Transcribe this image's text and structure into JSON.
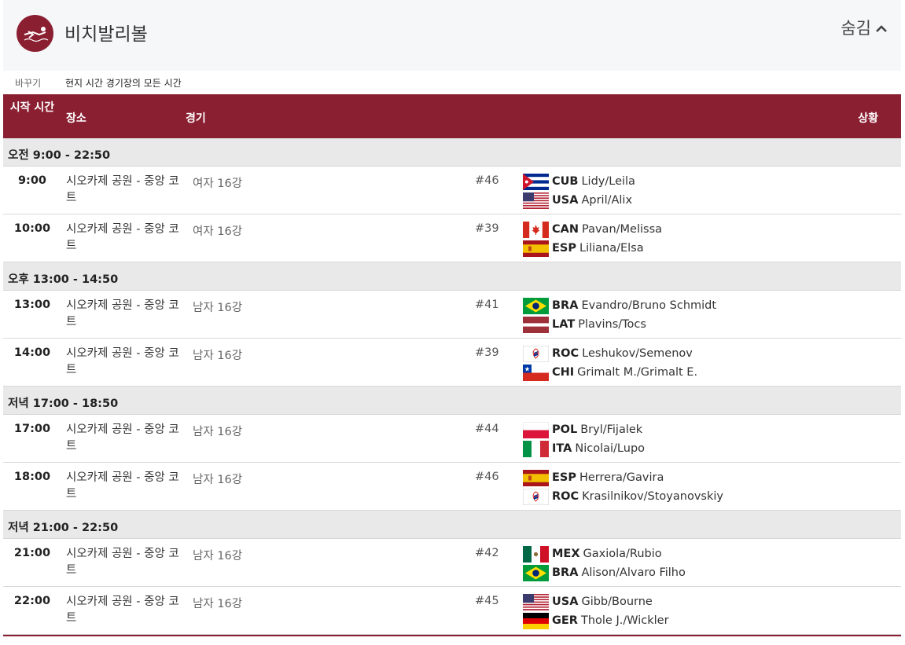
{
  "header": {
    "sport_name": "비치발리볼",
    "hide_label": "숨김"
  },
  "timezone": {
    "change_label": "바꾸기",
    "current_label": "현지 시간 경기장의 모든 시간"
  },
  "columns": {
    "time": "시작 시간",
    "venue": "장소",
    "event": "경기",
    "status": "상황"
  },
  "colors": {
    "brand": "#8b1f32",
    "header_bg": "#f6f7f9",
    "session_bg": "#e9e9e9"
  },
  "sessions": [
    {
      "label": "오전  9:00 - 22:50",
      "matches": [
        {
          "time": "9:00",
          "venue": "시오카제 공원 - 중앙 코트",
          "event": "여자 16강",
          "num": "#46",
          "teams": [
            {
              "flag": "CUB",
              "code": "CUB",
              "players": "Lidy/Leila"
            },
            {
              "flag": "USA",
              "code": "USA",
              "players": "April/Alix"
            }
          ]
        },
        {
          "time": "10:00",
          "venue": "시오카제 공원 - 중앙 코트",
          "event": "여자 16강",
          "num": "#39",
          "teams": [
            {
              "flag": "CAN",
              "code": "CAN",
              "players": "Pavan/Melissa"
            },
            {
              "flag": "ESP",
              "code": "ESP",
              "players": "Liliana/Elsa"
            }
          ]
        }
      ]
    },
    {
      "label": "오후  13:00 - 14:50",
      "matches": [
        {
          "time": "13:00",
          "venue": "시오카제 공원 - 중앙 코트",
          "event": "남자 16강",
          "num": "#41",
          "teams": [
            {
              "flag": "BRA",
              "code": "BRA",
              "players": "Evandro/Bruno Schmidt"
            },
            {
              "flag": "LAT",
              "code": "LAT",
              "players": "Plavins/Tocs"
            }
          ]
        },
        {
          "time": "14:00",
          "venue": "시오카제 공원 - 중앙 코트",
          "event": "남자 16강",
          "num": "#39",
          "teams": [
            {
              "flag": "ROC",
              "code": "ROC",
              "players": "Leshukov/Semenov"
            },
            {
              "flag": "CHI",
              "code": "CHI",
              "players": "Grimalt M./Grimalt E."
            }
          ]
        }
      ]
    },
    {
      "label": "저녁  17:00 - 18:50",
      "matches": [
        {
          "time": "17:00",
          "venue": "시오카제 공원 - 중앙 코트",
          "event": "남자 16강",
          "num": "#44",
          "teams": [
            {
              "flag": "POL",
              "code": "POL",
              "players": "Bryl/Fijalek"
            },
            {
              "flag": "ITA",
              "code": "ITA",
              "players": "Nicolai/Lupo"
            }
          ]
        },
        {
          "time": "18:00",
          "venue": "시오카제 공원 - 중앙 코트",
          "event": "남자 16강",
          "num": "#46",
          "teams": [
            {
              "flag": "ESP",
              "code": "ESP",
              "players": "Herrera/Gavira"
            },
            {
              "flag": "ROC",
              "code": "ROC",
              "players": "Krasilnikov/Stoyanovskiy"
            }
          ]
        }
      ]
    },
    {
      "label": "저녁  21:00 - 22:50",
      "matches": [
        {
          "time": "21:00",
          "venue": "시오카제 공원 - 중앙 코트",
          "event": "남자 16강",
          "num": "#42",
          "teams": [
            {
              "flag": "MEX",
              "code": "MEX",
              "players": "Gaxiola/Rubio"
            },
            {
              "flag": "BRA",
              "code": "BRA",
              "players": "Alison/Alvaro Filho"
            }
          ]
        },
        {
          "time": "22:00",
          "venue": "시오카제 공원 - 중앙 코트",
          "event": "남자 16강",
          "num": "#45",
          "teams": [
            {
              "flag": "USA",
              "code": "USA",
              "players": "Gibb/Bourne"
            },
            {
              "flag": "GER",
              "code": "GER",
              "players": "Thole J./Wickler"
            }
          ]
        }
      ]
    }
  ]
}
